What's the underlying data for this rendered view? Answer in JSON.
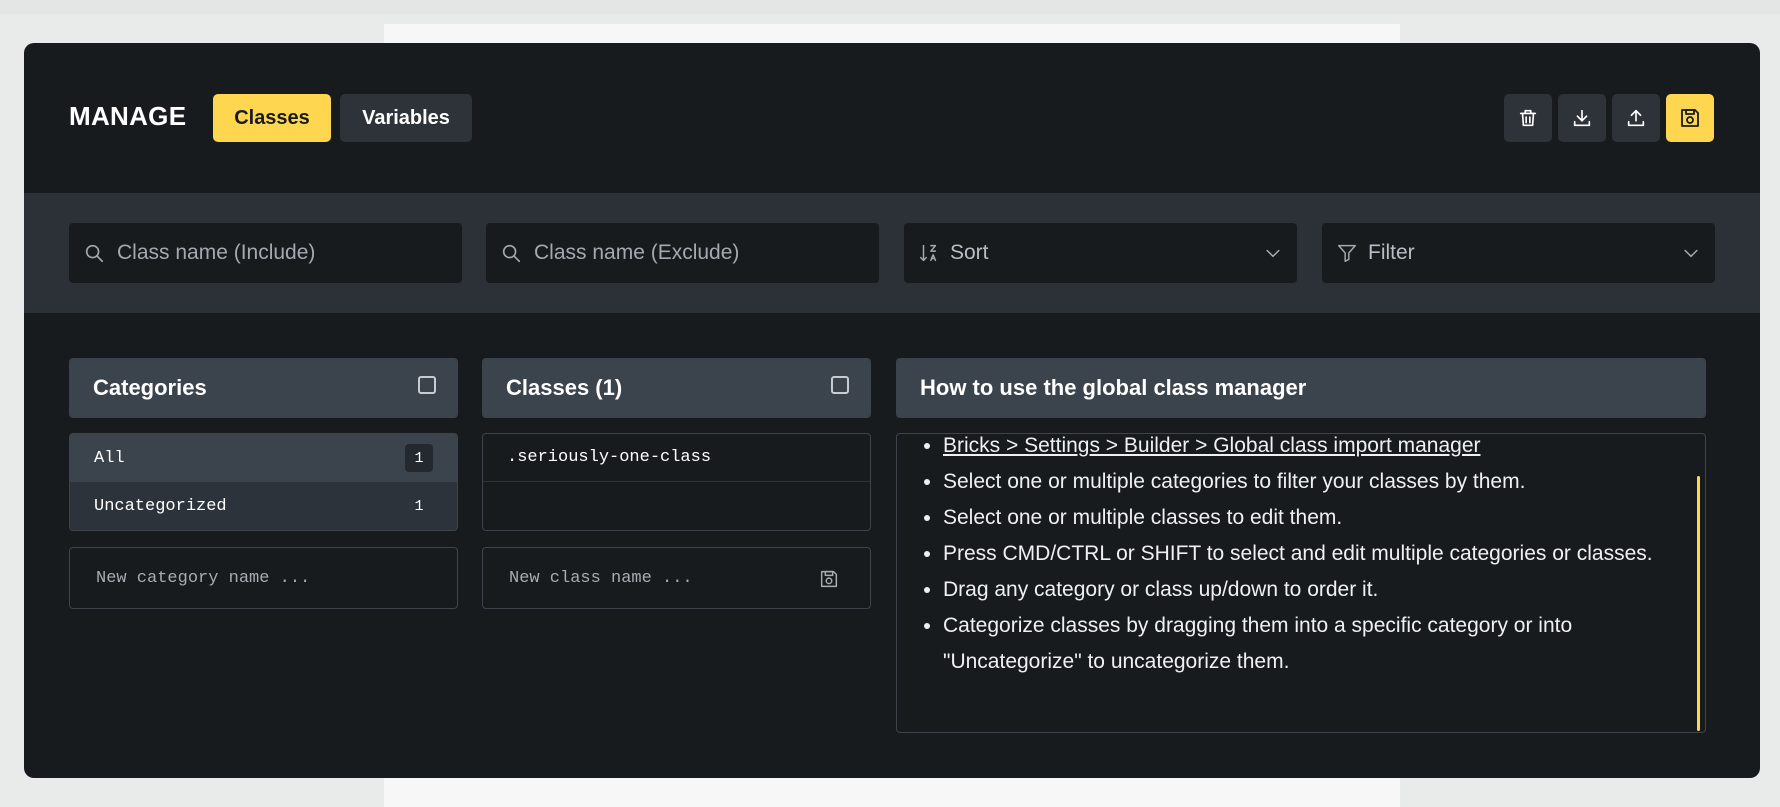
{
  "header": {
    "title": "MANAGE",
    "tabs": [
      {
        "label": "Classes",
        "active": true
      },
      {
        "label": "Variables",
        "active": false
      }
    ],
    "actions": [
      {
        "icon": "trash-icon"
      },
      {
        "icon": "download-icon"
      },
      {
        "icon": "upload-icon"
      },
      {
        "icon": "save-icon",
        "active": true
      }
    ]
  },
  "filters": {
    "include_placeholder": "Class name (Include)",
    "exclude_placeholder": "Class name (Exclude)",
    "sort_label": "Sort",
    "filter_label": "Filter"
  },
  "categories": {
    "title": "Categories",
    "items": [
      {
        "label": "All",
        "count": "1",
        "active": true
      },
      {
        "label": "Uncategorized",
        "count": "1",
        "active": false
      }
    ],
    "new_placeholder": "New category name ..."
  },
  "classes": {
    "title": "Classes (1)",
    "items": [
      {
        "label": ".seriously-one-class"
      }
    ],
    "new_placeholder": "New class name ..."
  },
  "help": {
    "title": "How to use the global class manager",
    "items": [
      "Bricks > Settings > Builder > Global class import manager",
      "Select one or multiple categories to filter your classes by them.",
      "Select one or multiple classes to edit them.",
      "Press CMD/CTRL or SHIFT to select and edit multiple categories or classes.",
      "Drag any category or class up/down to order it.",
      "Categorize classes by dragging them into a specific category or into \"Uncategorize\" to uncategorize them."
    ]
  },
  "colors": {
    "accent": "#ffd64f",
    "modal_bg": "#181b1e",
    "panel_head": "#3b434c"
  }
}
